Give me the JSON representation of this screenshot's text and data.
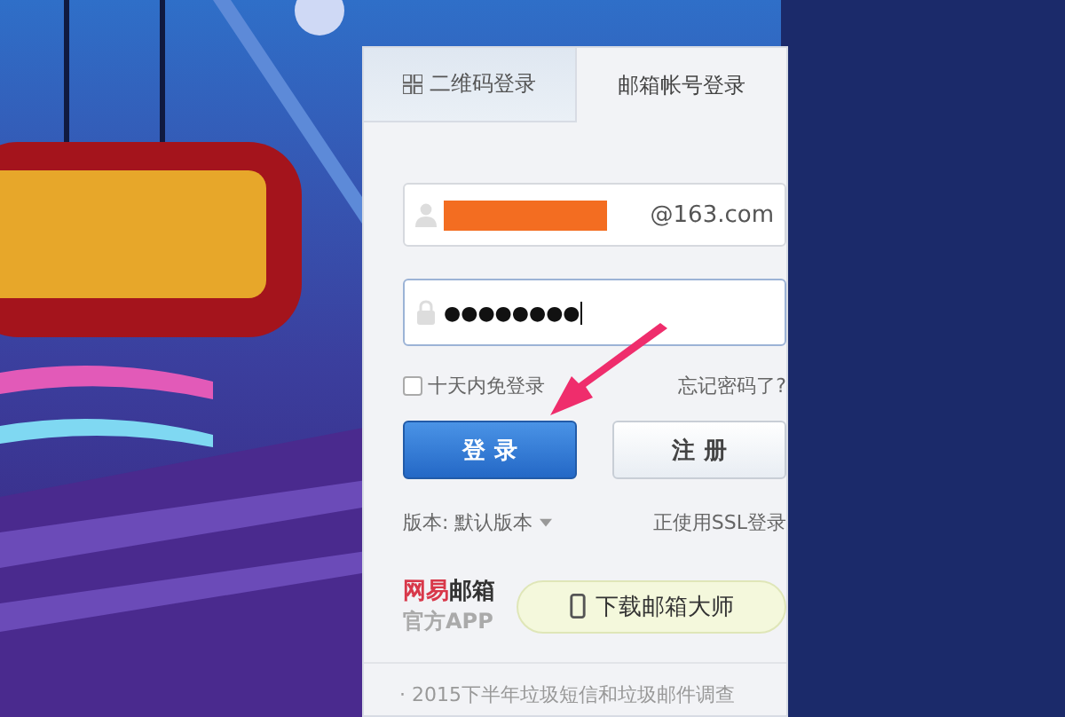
{
  "tabs": [
    {
      "label": "二维码登录",
      "kind": "qr",
      "selected": false
    },
    {
      "label": "邮箱帐号登录",
      "selected": true
    }
  ],
  "username": {
    "domain": "@163.com",
    "redacted": true
  },
  "password": {
    "value": "●●●●●●●●",
    "focused": true
  },
  "remember": {
    "label": "十天内免登录",
    "checked": false
  },
  "forgot_link": "忘记密码了?",
  "buttons": [
    {
      "label": "登 录",
      "kind": "primary"
    },
    {
      "label": "注 册",
      "kind": "secondary"
    }
  ],
  "version": {
    "label": "版本: 默认版本"
  },
  "ssl_link": "正使用SSL登录",
  "promo": {
    "brand_prefix": "网易",
    "brand": "邮箱",
    "subtitle": "官方APP",
    "download": "下载邮箱大师"
  },
  "news": [
    "· 2015下半年垃圾短信和垃圾邮件调查"
  ],
  "annotation": {
    "kind": "arrow"
  }
}
